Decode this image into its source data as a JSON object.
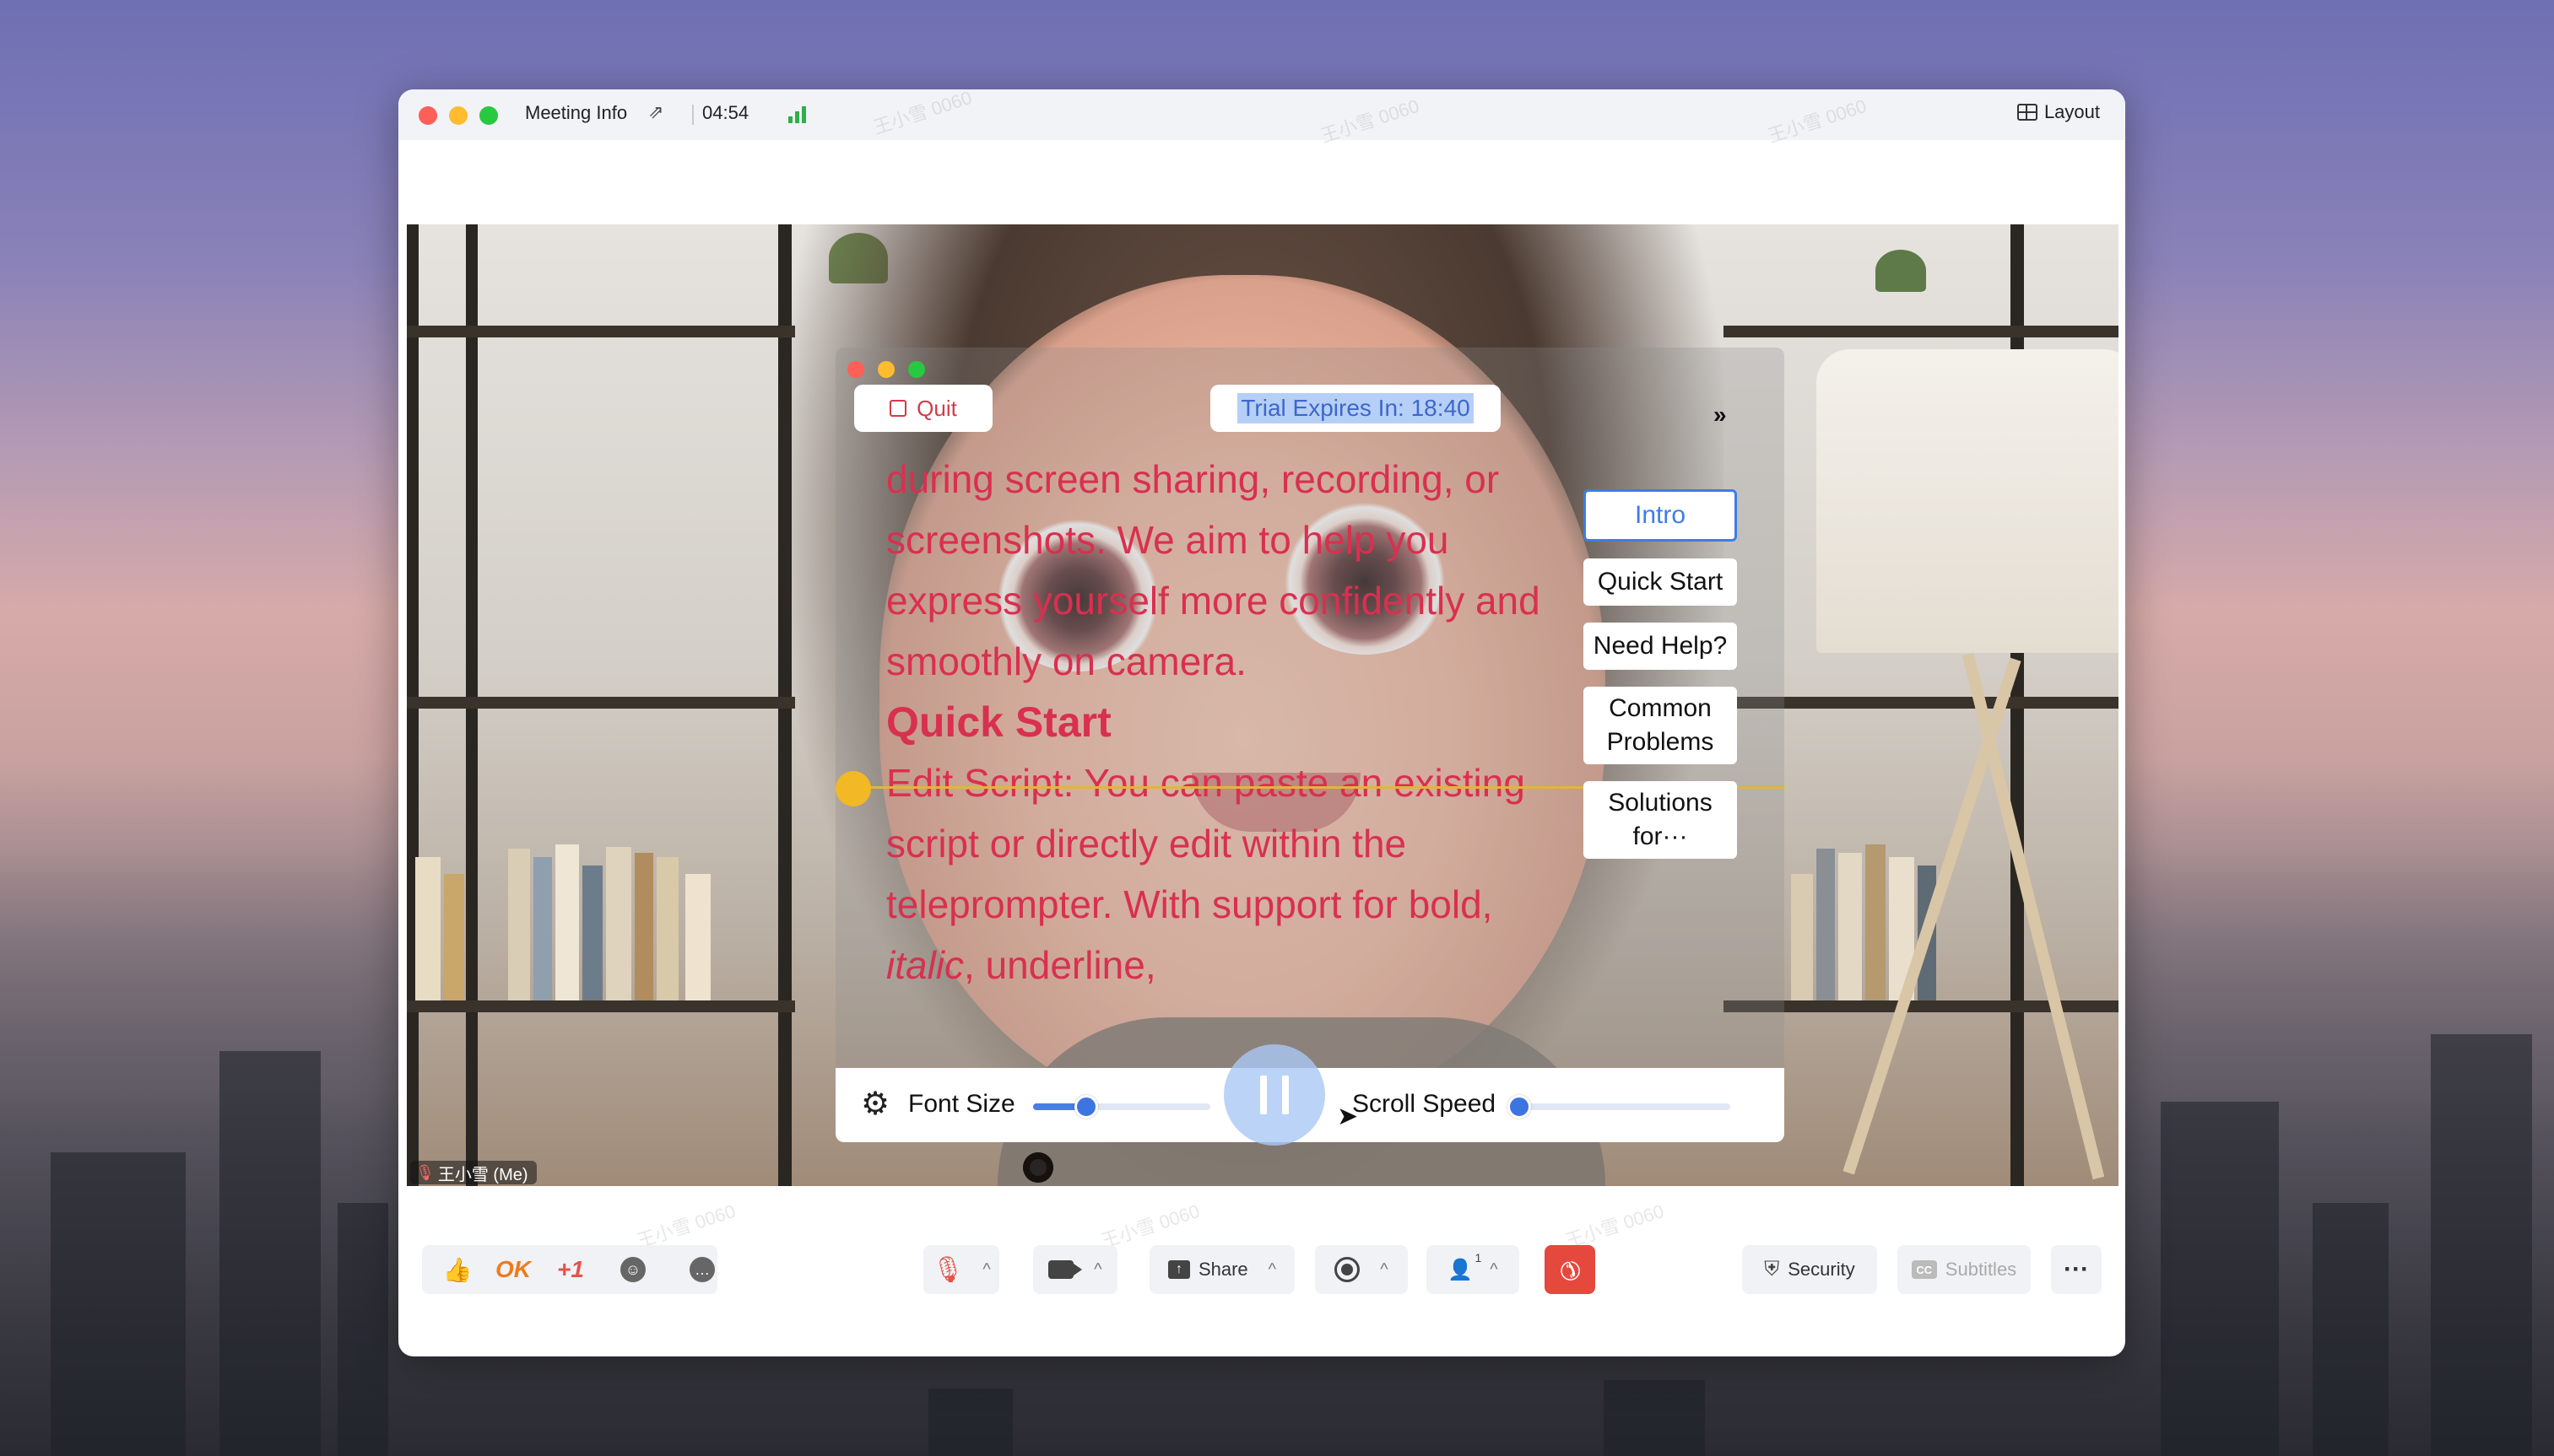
{
  "titlebar": {
    "meeting_info": "Meeting Info",
    "timer": "04:54",
    "layout_label": "Layout"
  },
  "participant": {
    "name": "王小雪 (Me)"
  },
  "watermark": "王小雪 0060",
  "teleprompter": {
    "quit_label": "Quit",
    "trial_text": "Trial Expires In: 18:40",
    "collapse_glyph": "»",
    "script": {
      "para1": "during screen sharing, recording, or screenshots. We aim to help you express yourself more confidently and smoothly on camera.",
      "heading": "Quick Start",
      "para2_before": "Edit Script: You can paste an existing script or directly edit within the teleprompter. With support for bold, ",
      "para2_italic": "italic",
      "para2_after": ", underline,"
    },
    "nav": [
      {
        "label": "Intro",
        "active": true
      },
      {
        "label": "Quick Start",
        "active": false
      },
      {
        "label": "Need Help?",
        "active": false
      },
      {
        "label": "Common Problems",
        "active": false
      },
      {
        "label": "Solutions for···",
        "active": false
      }
    ],
    "controls": {
      "font_size_label": "Font Size",
      "font_size_value": 0.3,
      "scroll_speed_label": "Scroll Speed",
      "scroll_speed_value": 0.0
    }
  },
  "toolbar": {
    "ok": "OK",
    "plus_one": "+1",
    "share_label": "Share",
    "participants_count": "1",
    "security_label": "Security",
    "subtitles_label": "Subtitles",
    "more_glyph": "···"
  },
  "colors": {
    "accent_blue": "#3c7de6",
    "script_red": "#d9304f",
    "end_call_red": "#e5483d",
    "reading_line": "#e2b43d"
  }
}
